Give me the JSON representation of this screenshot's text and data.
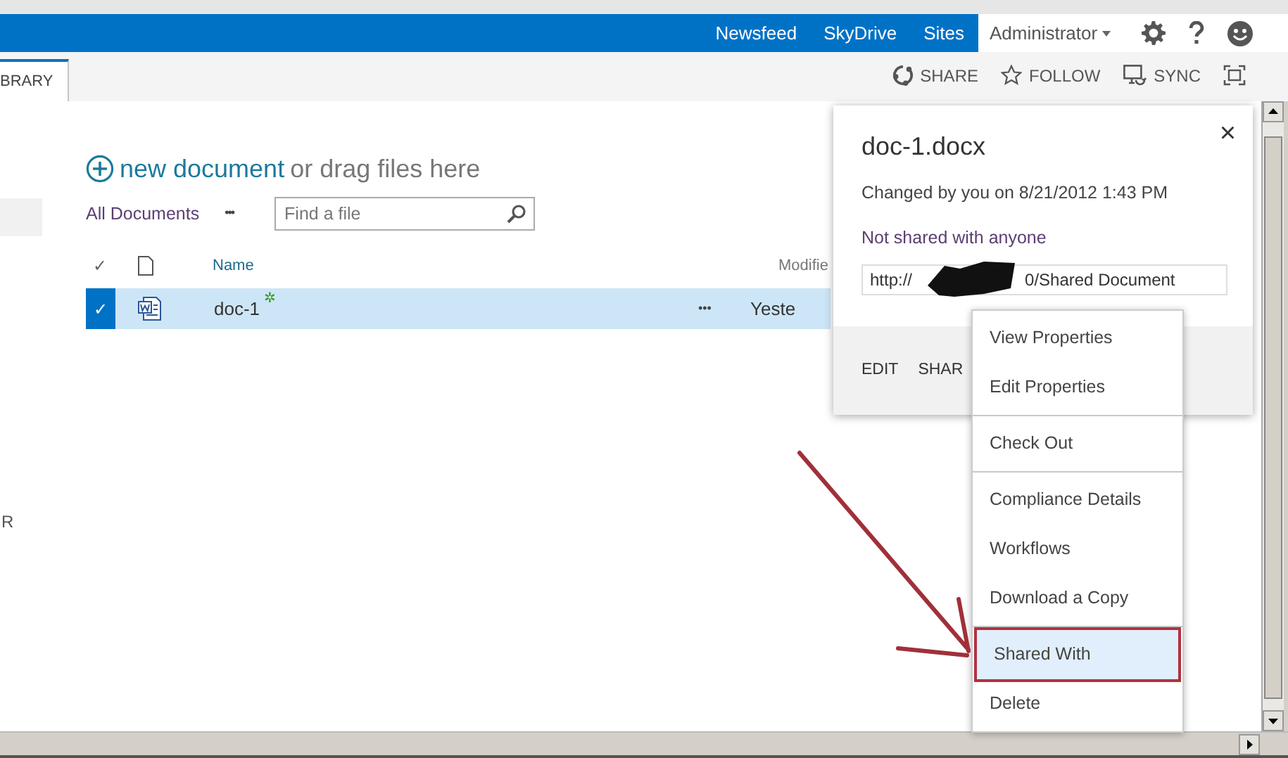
{
  "top_bar": {
    "links": [
      "Newsfeed",
      "SkyDrive",
      "Sites"
    ],
    "user": "Administrator"
  },
  "ribbon": {
    "tab": {
      "label": "BRARY",
      "selected": true
    },
    "actions": [
      "SHARE",
      "FOLLOW",
      "SYNC"
    ]
  },
  "left_nav": {
    "partial_text": "R"
  },
  "check_glyph": "✓",
  "close_glyph": "×",
  "library": {
    "new_document": "new document",
    "drag_hint": "or drag files here",
    "view": "All Documents",
    "view_menu": "•••",
    "search": {
      "placeholder": "Find a file"
    },
    "columns": [
      "Name",
      "Modifie"
    ],
    "rows": [
      {
        "name": "doc-1",
        "new_mark": "✲",
        "menu": "•••",
        "modified": "Yeste",
        "selected": true
      }
    ]
  },
  "callout": {
    "title": "doc-1.docx",
    "changed": "Changed by you on 8/21/2012 1:43 PM",
    "sharing": "Not shared with anyone",
    "url_visible_parts": [
      "http://",
      "0/Shared Document"
    ],
    "actions": [
      "EDIT",
      "SHAR"
    ]
  },
  "context_menu": {
    "groups": [
      [
        {
          "label": "View Properties",
          "selected": false
        },
        {
          "label": "Edit Properties",
          "selected": false
        }
      ],
      [
        {
          "label": "Check Out",
          "selected": false
        }
      ],
      [
        {
          "label": "Compliance Details",
          "selected": false
        },
        {
          "label": "Workflows",
          "selected": false
        },
        {
          "label": "Download a Copy",
          "selected": false
        }
      ],
      [
        {
          "label": "Shared With",
          "selected": true
        },
        {
          "label": "Delete",
          "selected": false
        }
      ]
    ]
  }
}
